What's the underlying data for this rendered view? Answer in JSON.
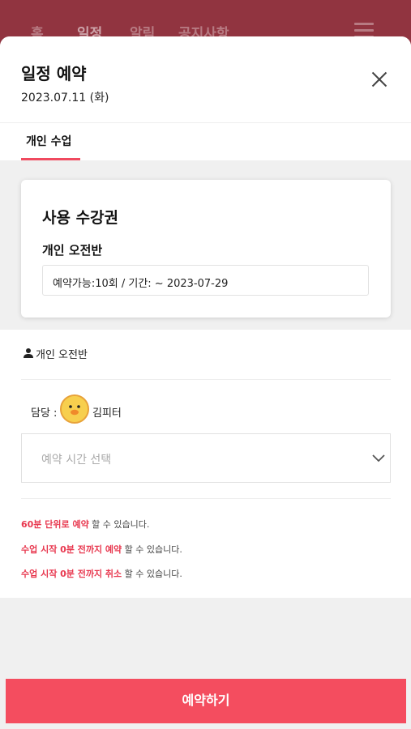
{
  "topbar": {
    "nav": [
      "홈",
      "일정",
      "알림",
      "공지사항"
    ]
  },
  "modal": {
    "title": "일정 예약",
    "date": "2023.07.11 (화)"
  },
  "tabs": [
    {
      "label": "개인 수업",
      "active": true
    }
  ],
  "pass_card": {
    "title": "사용 수강권",
    "class_name": "개인 오전반",
    "availability": "예약가능:10회 / 기간: ~ 2023-07-29"
  },
  "detail": {
    "class_name": "개인 오전반",
    "teacher_label": "담당 :",
    "teacher_name": "김피터",
    "time_select_placeholder": "예약 시간 선택"
  },
  "notes": [
    {
      "highlight": "60분 단위로 예약",
      "rest": " 할 수 있습니다."
    },
    {
      "highlight": "수업 시작 0분 전까지 예약",
      "rest": " 할 수 있습니다."
    },
    {
      "highlight": "수업 시작 0분 전까지 취소",
      "rest": " 할 수 있습니다."
    }
  ],
  "reserve_button": {
    "label": "예약하기"
  },
  "colors": {
    "accent": "#f44d5f",
    "highlight_text": "#e8384f",
    "topbar": "#913440"
  }
}
